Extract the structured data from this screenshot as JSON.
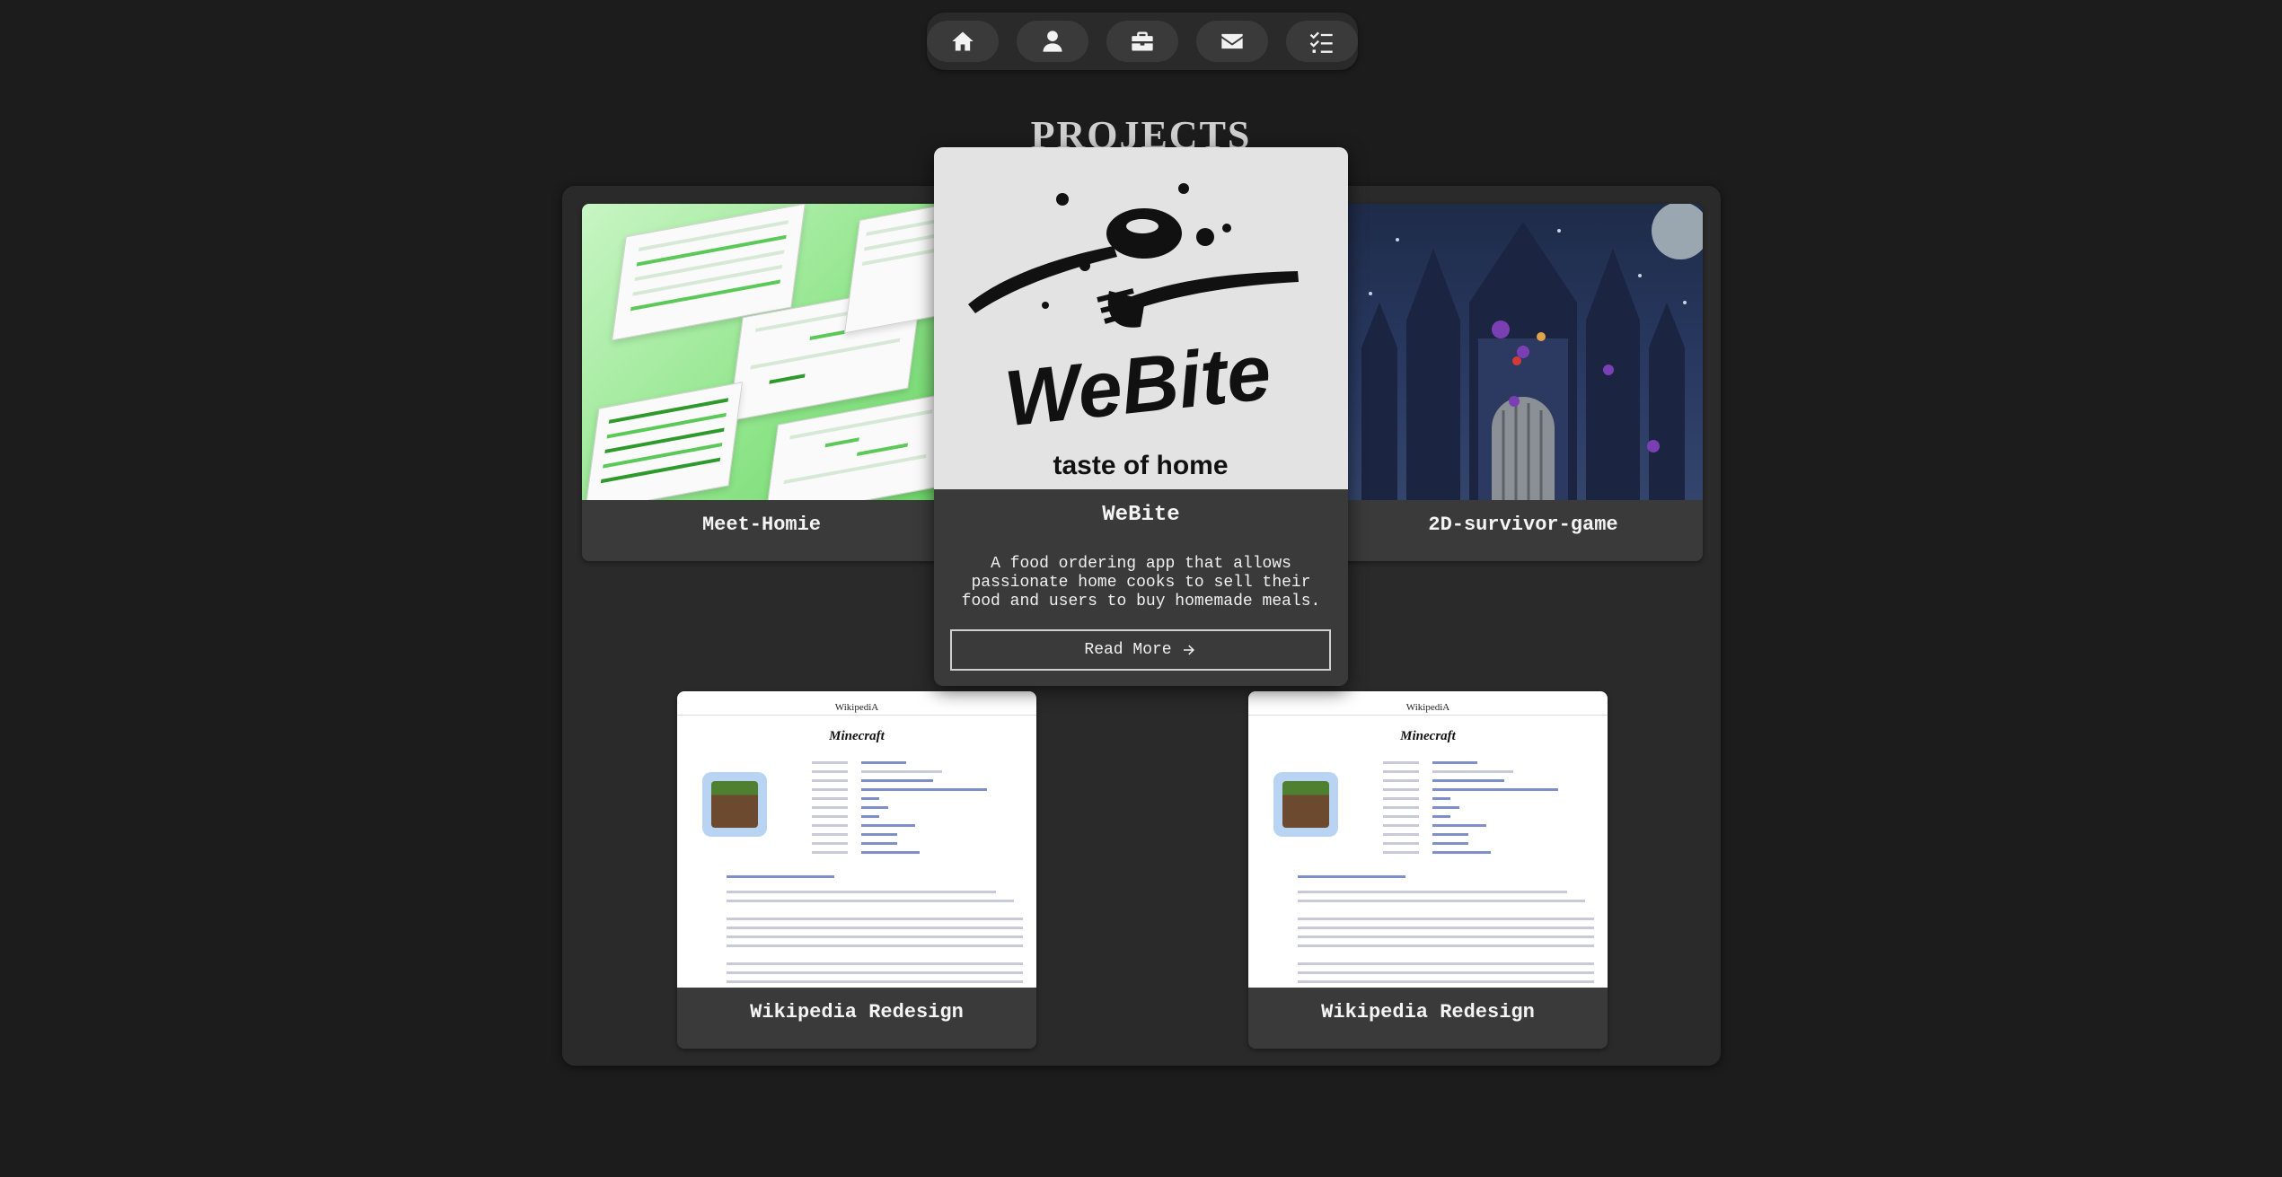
{
  "nav": {
    "items": [
      {
        "icon": "home-icon"
      },
      {
        "icon": "user-icon"
      },
      {
        "icon": "briefcase-icon"
      },
      {
        "icon": "envelope-icon"
      },
      {
        "icon": "tasks-icon"
      }
    ]
  },
  "section_title": "PROJECTS",
  "projects": [
    {
      "name": "Meet-Homie"
    },
    {
      "name": "WeBite"
    },
    {
      "name": "2D-survivor-game"
    },
    {
      "name": "Wikipedia Redesign"
    },
    {
      "name": "Wikipedia Redesign"
    }
  ],
  "expanded": {
    "logo_text": "WeBite",
    "logo_tagline": "taste of home",
    "title": "WeBite",
    "description": "A food ordering app that allows passionate home cooks to sell their food and users to buy homemade meals.",
    "button_label": "Read More",
    "button_icon": "arrow-right-icon"
  },
  "wiki_preview": {
    "logo": "WikipediA",
    "title": "Minecraft"
  },
  "colors": {
    "background": "#1c1c1c",
    "panel": "#2a2a2a",
    "card": "#3a3a3a",
    "accent_green": "#6fd86a"
  }
}
